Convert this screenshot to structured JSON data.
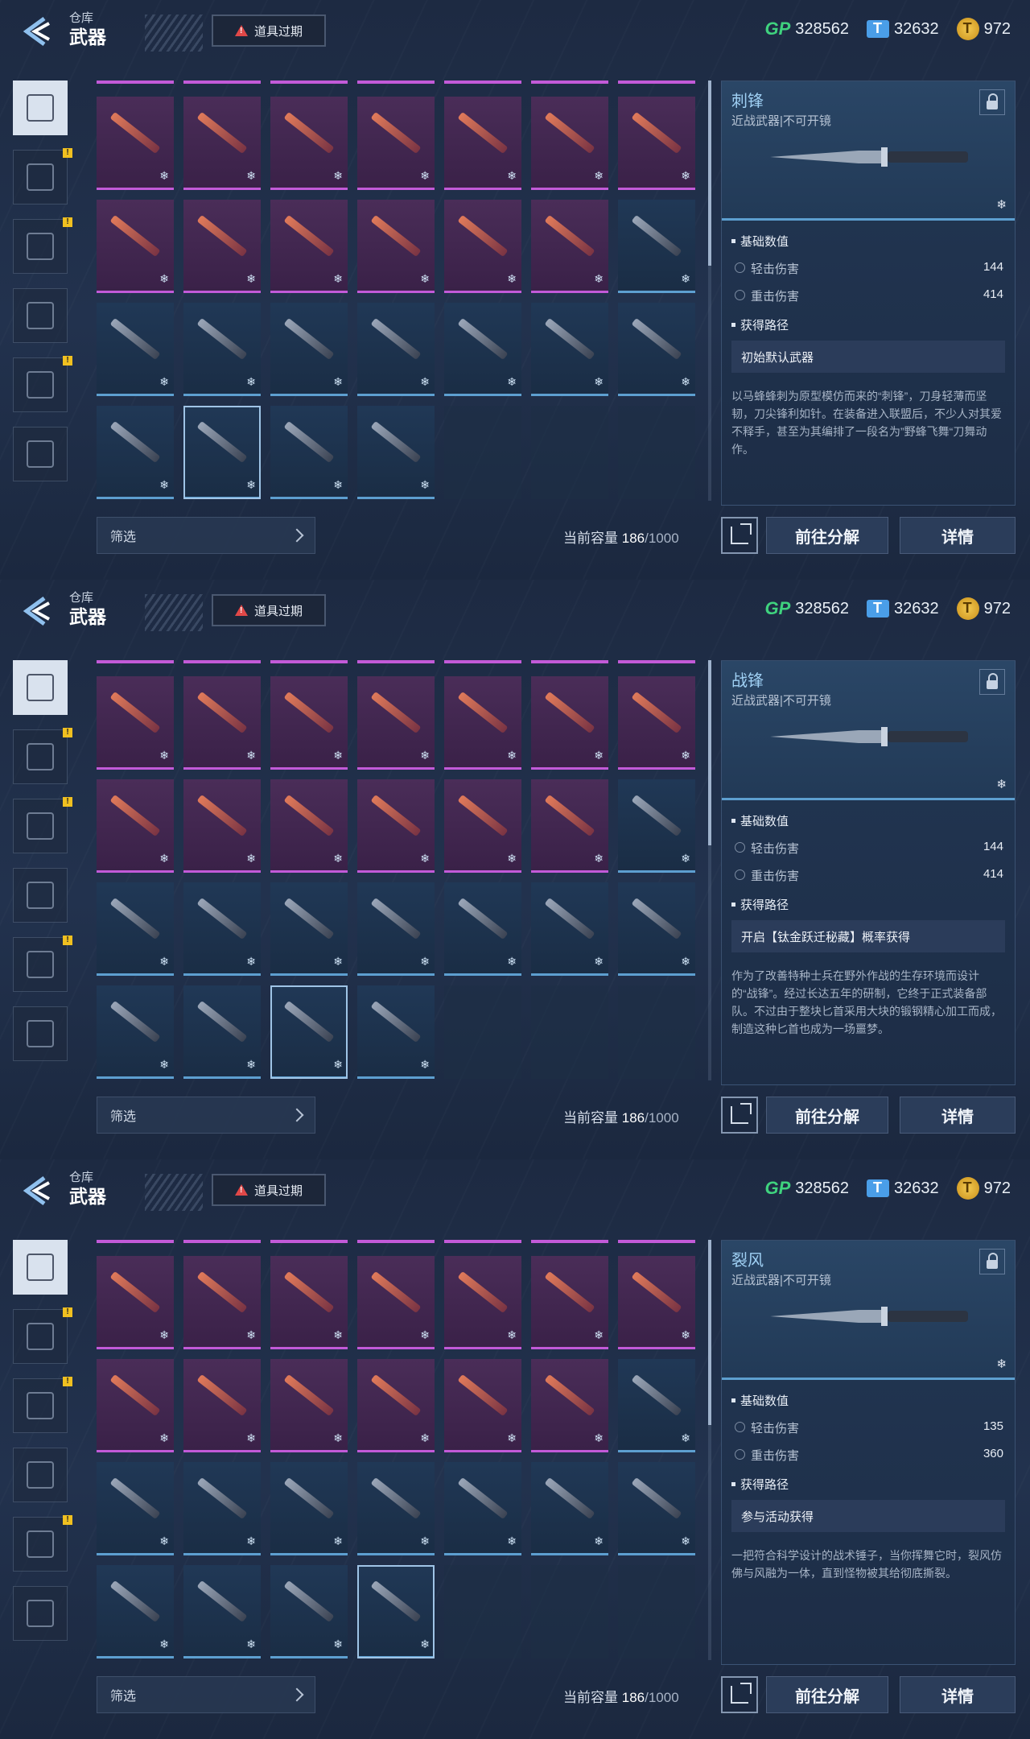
{
  "colors": {
    "accent": "#5d9fd0",
    "rare_purple": "#c25ad8",
    "alert": "#e04848",
    "gp": "#3fd27e",
    "gold": "#f3c950"
  },
  "header": {
    "crumb": "仓库",
    "title": "武器",
    "alert_label": "道具过期",
    "alert_icon": "warning-icon"
  },
  "currency": {
    "gp": "328562",
    "ticket": "32632",
    "gold": "972",
    "gp_label": "GP"
  },
  "categories": [
    {
      "icon": "pistol-icon",
      "active": true
    },
    {
      "icon": "card-icon",
      "badge": "!"
    },
    {
      "icon": "device-icon",
      "badge": "!"
    },
    {
      "icon": "gun-part-icon"
    },
    {
      "icon": "compass-icon",
      "badge": "!"
    },
    {
      "icon": "star-badge-icon"
    }
  ],
  "filter": {
    "label": "筛选"
  },
  "capacity": {
    "label": "当前容量",
    "current": "186",
    "total": "/1000"
  },
  "buttons": {
    "dismantle": "前往分解",
    "detail": "详情"
  },
  "sections": {
    "stats": "基础数值",
    "source": "获得路径",
    "light": "轻击伤害",
    "heavy": "重击伤害"
  },
  "views": [
    {
      "item": {
        "name": "刺锋",
        "type": "近战武器|不可开镜",
        "light": "144",
        "heavy": "414",
        "source": "初始默认武器",
        "desc": "以马蜂蜂刺为原型模仿而来的“刺锋”，刀身轻薄而坚韧，刀尖锋利如针。在装备进入联盟后，不少人对其爱不释手，甚至为其编排了一段名为”野蜂飞舞“刀舞动作。"
      },
      "selected": 22
    },
    {
      "item": {
        "name": "战锋",
        "type": "近战武器|不可开镜",
        "light": "144",
        "heavy": "414",
        "source": "开启【钛金跃迁秘藏】概率获得",
        "desc": "作为了改善特种士兵在野外作战的生存环境而设计的“战锋”。经过长达五年的研制，它终于正式装备部队。不过由于整块匕首采用大块的锻钢精心加工而成，制造这种匕首也成为一场噩梦。"
      },
      "selected": 23
    },
    {
      "item": {
        "name": "裂风",
        "type": "近战武器|不可开镜",
        "light": "135",
        "heavy": "360",
        "source": "参与活动获得",
        "desc": "一把符合科学设计的战术锤子，当你挥舞它时，裂风仿佛与风融为一体，直到怪物被其给彻底撕裂。"
      },
      "selected": 24
    }
  ]
}
